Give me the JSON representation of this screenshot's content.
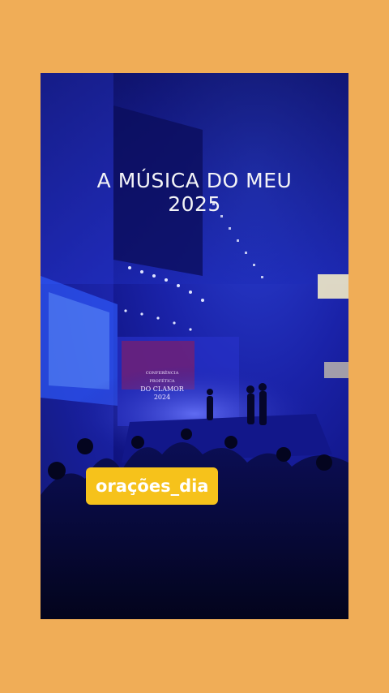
{
  "overlay": {
    "line1": "A MÚSICA DO MEU",
    "line2": "2025"
  },
  "stage_screen": {
    "line1": "CONFERÊNCIA PROFÉTICA",
    "line2": "DO CLAMOR 2024"
  },
  "badge": {
    "label": "orações_dia"
  },
  "colors": {
    "background": "#f0ad57",
    "badge": "#f6c21b",
    "scene_blue": "#1a22a8"
  }
}
